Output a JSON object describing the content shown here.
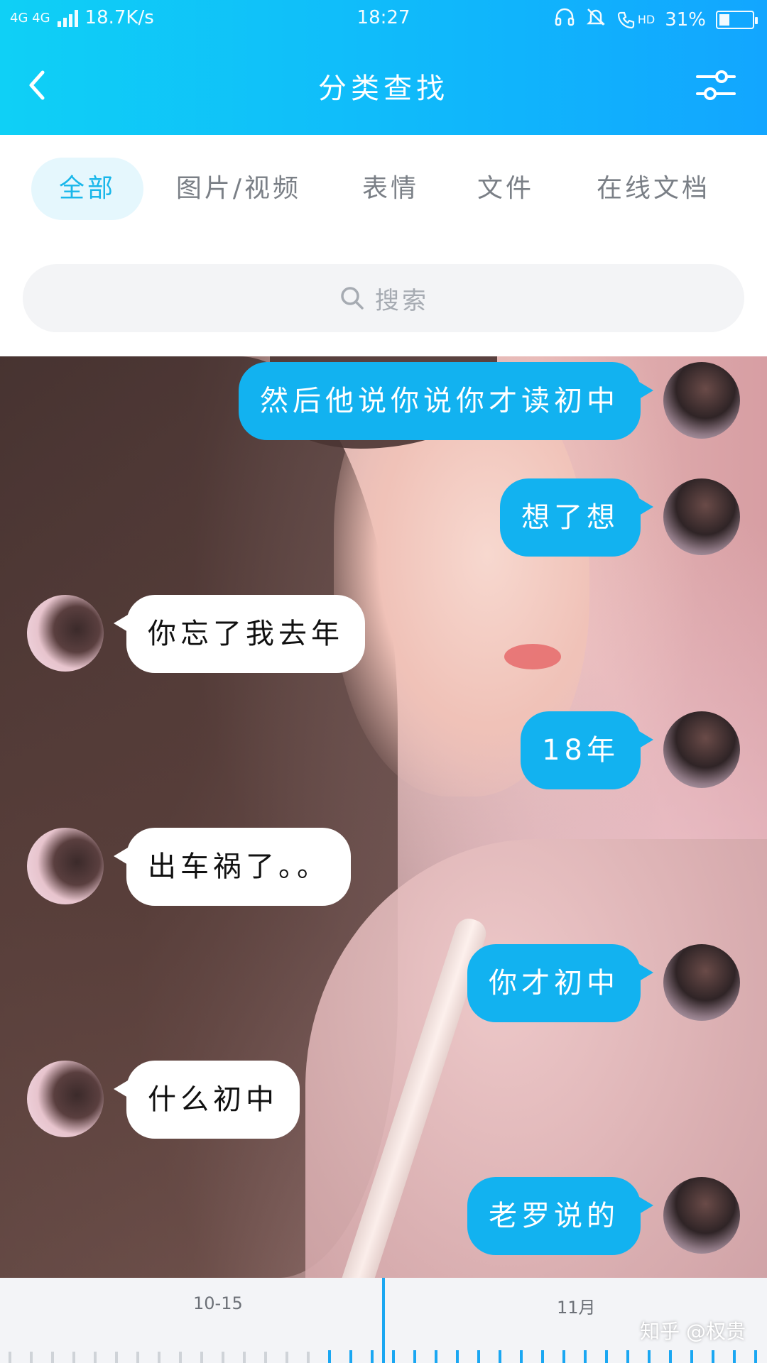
{
  "status_bar": {
    "network": "4G 4G",
    "speed": "18.7K/s",
    "time": "18:27",
    "hd": "HD",
    "battery": "31%",
    "battery_level": 0.31
  },
  "nav": {
    "title": "分类查找"
  },
  "tabs": [
    {
      "label": "全部",
      "active": true
    },
    {
      "label": "图片/视频",
      "active": false
    },
    {
      "label": "表情",
      "active": false
    },
    {
      "label": "文件",
      "active": false
    },
    {
      "label": "在线文档",
      "active": false
    }
  ],
  "search": {
    "placeholder": "搜索"
  },
  "messages": [
    {
      "from": "me",
      "text": "然后他说你说你才读初中"
    },
    {
      "from": "me",
      "text": "想了想"
    },
    {
      "from": "her",
      "text": "你忘了我去年"
    },
    {
      "from": "me",
      "text": "18年"
    },
    {
      "from": "her",
      "text": "出车祸了。。"
    },
    {
      "from": "me",
      "text": "你才初中"
    },
    {
      "from": "her",
      "text": "什么初中"
    },
    {
      "from": "me",
      "text": "老罗说的"
    }
  ],
  "timeline": {
    "label_left": "10-15",
    "label_right": "11月"
  },
  "watermark": "知乎 @权贵",
  "colors": {
    "accent": "#12b2f0",
    "tab_active": "#19b7ea",
    "tab_active_bg": "#e5f7fd"
  }
}
